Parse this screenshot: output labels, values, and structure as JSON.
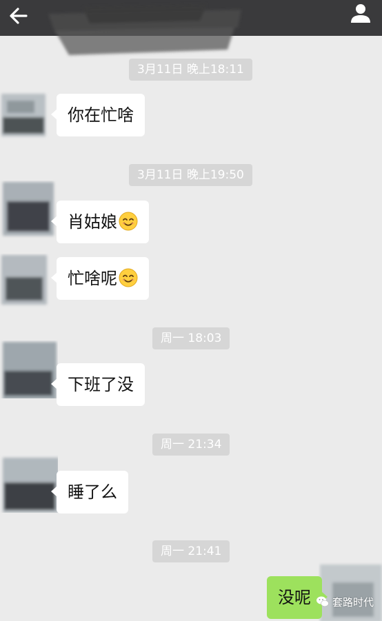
{
  "header": {
    "back_icon": "arrow-left-icon",
    "contact_icon": "person-icon",
    "background": "#3a3a3c"
  },
  "timestamps": [
    "3月11日 晚上18:11",
    "3月11日 晚上19:50",
    "周一 18:03",
    "周一 21:34",
    "周一 21:41"
  ],
  "messages": [
    {
      "from": "contact",
      "text": "你在忙啥",
      "emoji": ""
    },
    {
      "from": "contact",
      "text": "肖姑娘",
      "emoji": "smiling-face-emoji"
    },
    {
      "from": "contact",
      "text": "忙啥呢",
      "emoji": "smiling-face-emoji"
    },
    {
      "from": "contact",
      "text": "下班了没",
      "emoji": ""
    },
    {
      "from": "contact",
      "text": "睡了么",
      "emoji": ""
    },
    {
      "from": "self",
      "text": "没呢",
      "emoji": ""
    }
  ],
  "watermark": {
    "text": "套路时代",
    "icon": "wechat-icon"
  },
  "colors": {
    "chat_bg": "#ebebeb",
    "incoming_bubble": "#ffffff",
    "outgoing_bubble": "#9de15d",
    "timestamp_bg": "#d6d6d6"
  }
}
